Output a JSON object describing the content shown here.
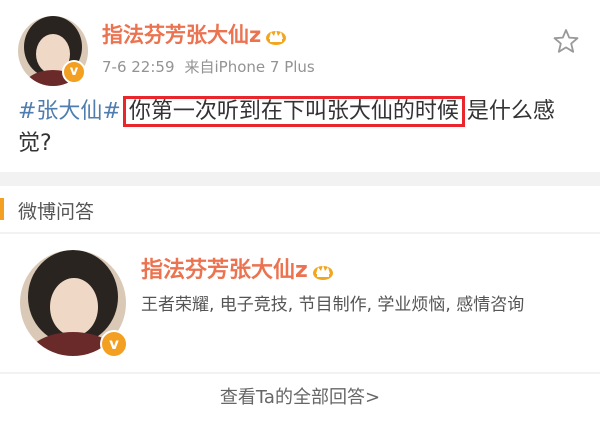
{
  "post": {
    "username": "指法芬芳张大仙z",
    "time": "7-6 22:59",
    "source": "来自iPhone 7 Plus",
    "topic": "#张大仙#",
    "highlighted_text": "你第一次听到在下叫张大仙的时候",
    "remaining_text": "是什么感觉?",
    "colors": {
      "username": "#eb7350",
      "topic": "#507daf",
      "highlight_box": "#e8262c"
    }
  },
  "section": {
    "title": "微博问答",
    "accent_color": "#f29f22"
  },
  "answerer": {
    "username": "指法芬芳张大仙z",
    "tags": "王者荣耀, 电子竞技, 节目制作, 学业烦恼, 感情咨询"
  },
  "footer": {
    "view_all_label": "查看Ta的全部回答>"
  },
  "icons": {
    "verified_badge": "v",
    "crown": "crown-icon",
    "favorite": "star-outline-icon"
  }
}
